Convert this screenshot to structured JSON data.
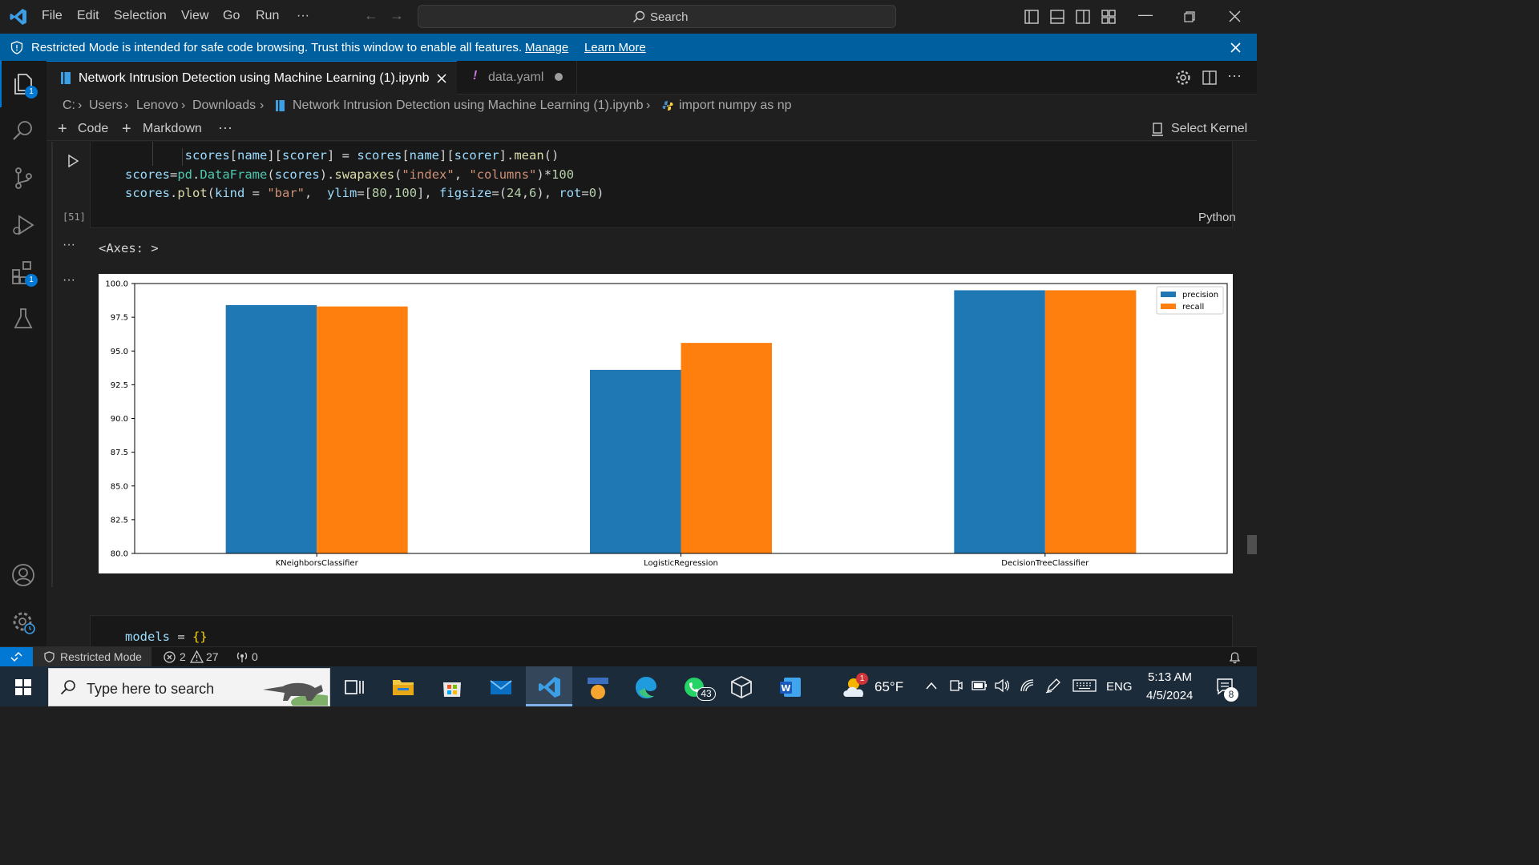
{
  "titlebar": {
    "menu": [
      "File",
      "Edit",
      "Selection",
      "View",
      "Go",
      "Run",
      "···"
    ],
    "search_label": "Search"
  },
  "banner": {
    "text": "Restricted Mode is intended for safe code browsing. Trust this window to enable all features.",
    "manage": "Manage",
    "learn_more": "Learn More"
  },
  "activity": {
    "explorer_badge": "1",
    "extensions_badge": "1"
  },
  "tabs": [
    {
      "label": "Network Intrusion Detection using Machine Learning (1).ipynb",
      "active": true
    },
    {
      "label": "data.yaml",
      "active": false,
      "modified": true
    }
  ],
  "breadcrumb": [
    "C:",
    "Users",
    "Lenovo",
    "Downloads",
    "Network Intrusion Detection using Machine Learning (1).ipynb",
    "import numpy as np"
  ],
  "nbtoolbar": {
    "code": "Code",
    "markdown": "Markdown",
    "more": "···",
    "select_kernel": "Select Kernel"
  },
  "cell": {
    "line1": "        scores[name][scorer] = scores[name][scorer].mean()",
    "line2": "scores=pd.DataFrame(scores).swapaxes(\"index\", \"columns\")*100",
    "line3": "scores.plot(kind = \"bar\",  ylim=[80,100], figsize=(24,6), rot=0)",
    "exec_count": "[51]",
    "language": "Python",
    "output_text": "<Axes: >",
    "more1": "···",
    "more2": "···",
    "next_line": "models = {}"
  },
  "chart_data": {
    "type": "bar",
    "categories": [
      "KNeighborsClassifier",
      "LogisticRegression",
      "DecisionTreeClassifier"
    ],
    "series": [
      {
        "name": "precision",
        "color": "#1f77b4",
        "values": [
          98.4,
          93.6,
          99.5
        ]
      },
      {
        "name": "recall",
        "color": "#ff7f0e",
        "values": [
          98.3,
          95.6,
          99.5
        ]
      }
    ],
    "ylim": [
      80,
      100
    ],
    "yticks": [
      "80.0",
      "82.5",
      "85.0",
      "87.5",
      "90.0",
      "92.5",
      "95.0",
      "97.5",
      "100.0"
    ],
    "legend": "top-right",
    "grid": false
  },
  "statusbar": {
    "restricted": "Restricted Mode",
    "errors": "2",
    "warnings": "27",
    "ports": "0"
  },
  "taskbar": {
    "search_placeholder": "Type here to search",
    "weather": "65°F",
    "lang": "ENG",
    "time": "5:13 AM",
    "date": "4/5/2024",
    "whatsapp_badge": "43",
    "notif_badge": "8",
    "weather_badge": "1"
  }
}
